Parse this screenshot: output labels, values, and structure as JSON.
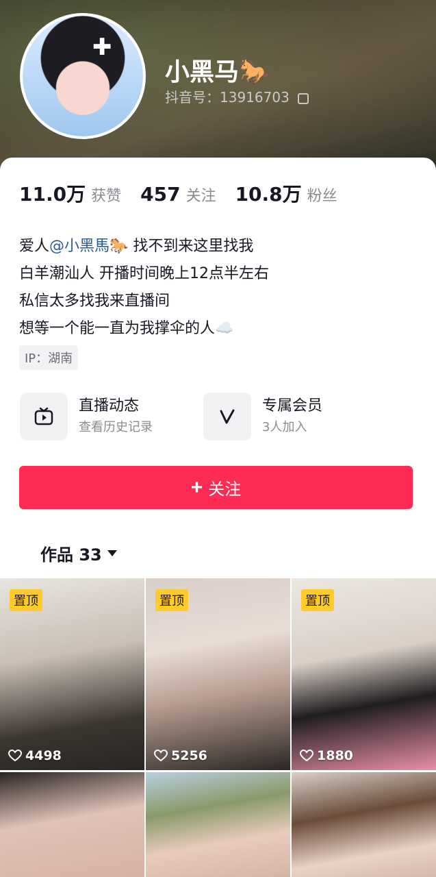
{
  "profile": {
    "username": "小黑马🐎",
    "douyin_id": "抖音号：13916703"
  },
  "stats": [
    {
      "value": "11.0万",
      "label": "获赞"
    },
    {
      "value": "457",
      "label": "关注"
    },
    {
      "value": "10.8万",
      "label": "粉丝"
    }
  ],
  "bio": {
    "line1_prefix": "爱人",
    "line1_mention": "@小黑馬🐎",
    "line1_suffix": " 找不到来这里找我",
    "line2": "白羊潮汕人 开播时间晚上12点半左右",
    "line3": "私信太多找我来直播间",
    "line4": "想等一个能一直为我撑伞的人☁️"
  },
  "ip": "IP：湖南",
  "features": [
    {
      "title": "直播动态",
      "subtitle": "查看历史记录",
      "icon": "live-tv-icon"
    },
    {
      "title": "专属会员",
      "subtitle": "3人加入",
      "icon": "v-member-icon"
    }
  ],
  "follow_button": {
    "label": "关注"
  },
  "works_tab": {
    "label": "作品 33"
  },
  "videos": [
    {
      "pinned": "置顶",
      "likes": "4498"
    },
    {
      "pinned": "置顶",
      "likes": "5256"
    },
    {
      "pinned": "置顶",
      "likes": "1880"
    },
    {
      "pinned": "",
      "likes": ""
    },
    {
      "pinned": "",
      "likes": ""
    },
    {
      "pinned": "",
      "likes": ""
    }
  ],
  "colors": {
    "accent": "#fe2c55",
    "pin": "#fecb2c",
    "mention": "#2c5a8f"
  }
}
